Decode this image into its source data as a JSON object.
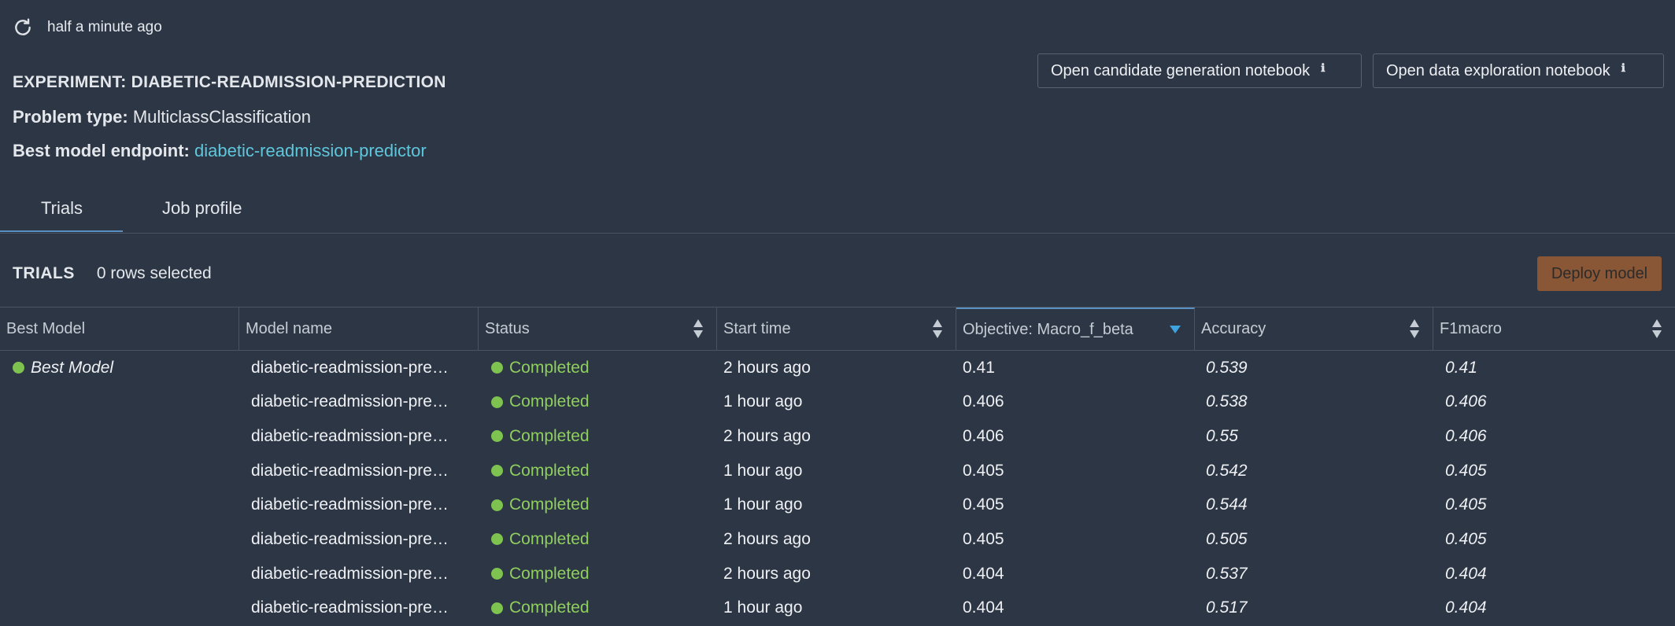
{
  "refresh": {
    "icon": "refresh-icon",
    "text": "half a minute ago"
  },
  "experiment": {
    "title": "EXPERIMENT: DIABETIC-READMISSION-PREDICTION",
    "problem_type_label": "Problem type:",
    "problem_type_value": "MulticlassClassification",
    "endpoint_label": "Best model endpoint:",
    "endpoint_value": "diabetic-readmission-predictor"
  },
  "notebooks": {
    "candidate": "Open candidate generation notebook",
    "exploration": "Open data exploration notebook",
    "info_icon": "info-icon"
  },
  "tabs": [
    {
      "label": "Trials",
      "active": true
    },
    {
      "label": "Job profile",
      "active": false
    }
  ],
  "trials": {
    "label": "TRIALS",
    "selected": "0 rows selected",
    "deploy_label": "Deploy model"
  },
  "columns": [
    "Best Model",
    "Model name",
    "Status",
    "Start time",
    "Objective: Macro_f_beta",
    "Accuracy",
    "F1macro"
  ],
  "rows": [
    {
      "best": "Best Model",
      "name": "diabetic-readmission-pre…",
      "status": "Completed",
      "start": "2 hours ago",
      "objective": "0.41",
      "accuracy": "0.539",
      "f1": "0.41"
    },
    {
      "best": "",
      "name": "diabetic-readmission-pre…",
      "status": "Completed",
      "start": "1 hour ago",
      "objective": "0.406",
      "accuracy": "0.538",
      "f1": "0.406"
    },
    {
      "best": "",
      "name": "diabetic-readmission-pre…",
      "status": "Completed",
      "start": "2 hours ago",
      "objective": "0.406",
      "accuracy": "0.55",
      "f1": "0.406"
    },
    {
      "best": "",
      "name": "diabetic-readmission-pre…",
      "status": "Completed",
      "start": "1 hour ago",
      "objective": "0.405",
      "accuracy": "0.542",
      "f1": "0.405"
    },
    {
      "best": "",
      "name": "diabetic-readmission-pre…",
      "status": "Completed",
      "start": "1 hour ago",
      "objective": "0.405",
      "accuracy": "0.544",
      "f1": "0.405"
    },
    {
      "best": "",
      "name": "diabetic-readmission-pre…",
      "status": "Completed",
      "start": "2 hours ago",
      "objective": "0.405",
      "accuracy": "0.505",
      "f1": "0.405"
    },
    {
      "best": "",
      "name": "diabetic-readmission-pre…",
      "status": "Completed",
      "start": "2 hours ago",
      "objective": "0.404",
      "accuracy": "0.537",
      "f1": "0.404"
    },
    {
      "best": "",
      "name": "diabetic-readmission-pre…",
      "status": "Completed",
      "start": "1 hour ago",
      "objective": "0.404",
      "accuracy": "0.517",
      "f1": "0.404"
    }
  ],
  "colors": {
    "background": "#2d3645",
    "link": "#5fc7dc",
    "status": "#8fcf5d",
    "deploy": "#8a5736",
    "accent": "#5a8fc2"
  }
}
